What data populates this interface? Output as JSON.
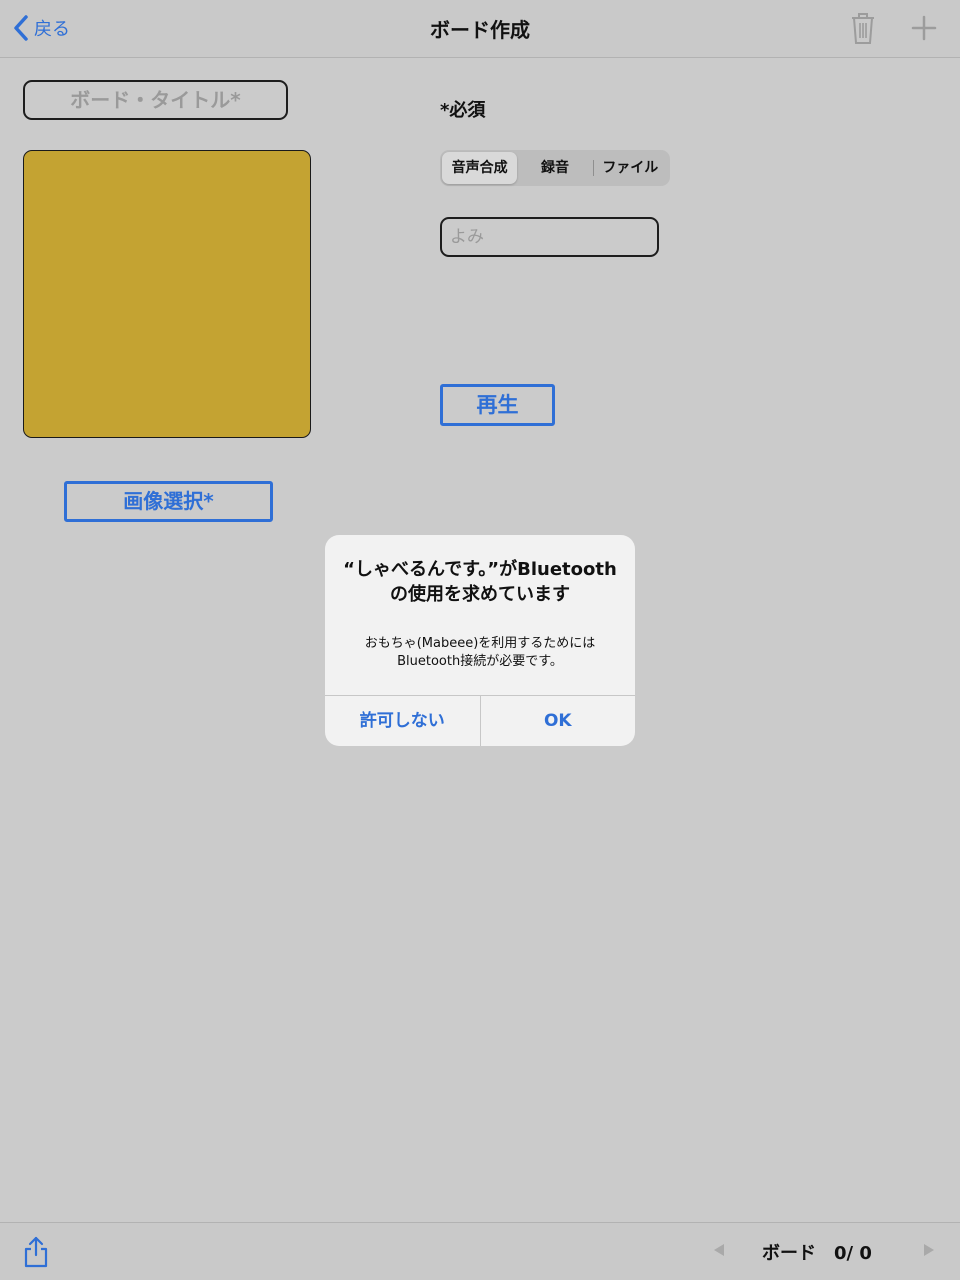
{
  "navbar": {
    "back_label": "戻る",
    "title": "ボード作成",
    "icons": [
      "chevron-left-icon",
      "trash-icon",
      "plus-icon"
    ]
  },
  "left": {
    "title_placeholder": "ボード・タイトル*",
    "image_color": "#c4a332",
    "select_image_label": "画像選択*"
  },
  "right": {
    "required_note": "*必須",
    "segments": [
      {
        "label": "音声合成",
        "selected": true
      },
      {
        "label": "録音",
        "selected": false
      },
      {
        "label": "ファイル",
        "selected": false
      }
    ],
    "reading_placeholder": "よみ",
    "play_label": "再生"
  },
  "alert": {
    "title": "“しゃべるんです。”がBluetoothの使用を求めています",
    "message": "おもちゃ(Mabeee)を利用するためにはBluetooth接続が必要です。",
    "deny_label": "許可しない",
    "ok_label": "OK"
  },
  "toolbar": {
    "board_counter": "ボード　0/ 0",
    "icons": [
      "share-icon",
      "previous-icon",
      "next-icon"
    ]
  },
  "colors": {
    "accent": "#2f6fd6",
    "background": "#cbcbcb",
    "alert_background": "#f2f2f2"
  }
}
